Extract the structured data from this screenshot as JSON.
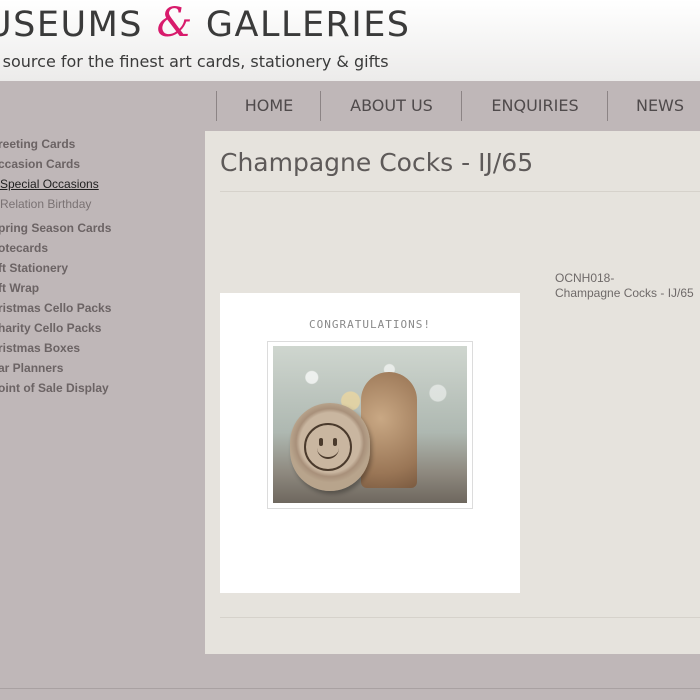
{
  "header": {
    "logo_left": "USEUMS",
    "logo_amp": "&",
    "logo_right": "GALLERIES",
    "tagline": "r source for the finest art cards, stationery & gifts"
  },
  "nav": {
    "items": [
      {
        "label": "HOME"
      },
      {
        "label": "ABOUT US"
      },
      {
        "label": "ENQUIRIES"
      },
      {
        "label": "NEWS"
      }
    ]
  },
  "sidebar": {
    "items": [
      {
        "label": "reeting Cards"
      },
      {
        "label": "ccasion Cards"
      },
      {
        "label": "Special Occasions",
        "state": "active"
      },
      {
        "label": "Relation Birthday",
        "state": "sub"
      },
      {
        "label": "pring Season Cards"
      },
      {
        "label": "otecards"
      },
      {
        "label": "ft Stationery"
      },
      {
        "label": "ft Wrap"
      },
      {
        "label": "ristmas Cello Packs"
      },
      {
        "label": "harity Cello Packs"
      },
      {
        "label": "ristmas Boxes"
      },
      {
        "label": "ar Planners"
      },
      {
        "label": "oint of Sale Display"
      }
    ]
  },
  "product": {
    "title": "Champagne Cocks - IJ/65",
    "card_caption": "CONGRATULATIONS!",
    "code": "OCNH018-",
    "name": "Champagne Cocks - IJ/65"
  },
  "colors": {
    "accent": "#d81b6c",
    "page_bg": "#bfb7b8",
    "content_bg": "#e6e3dd"
  }
}
